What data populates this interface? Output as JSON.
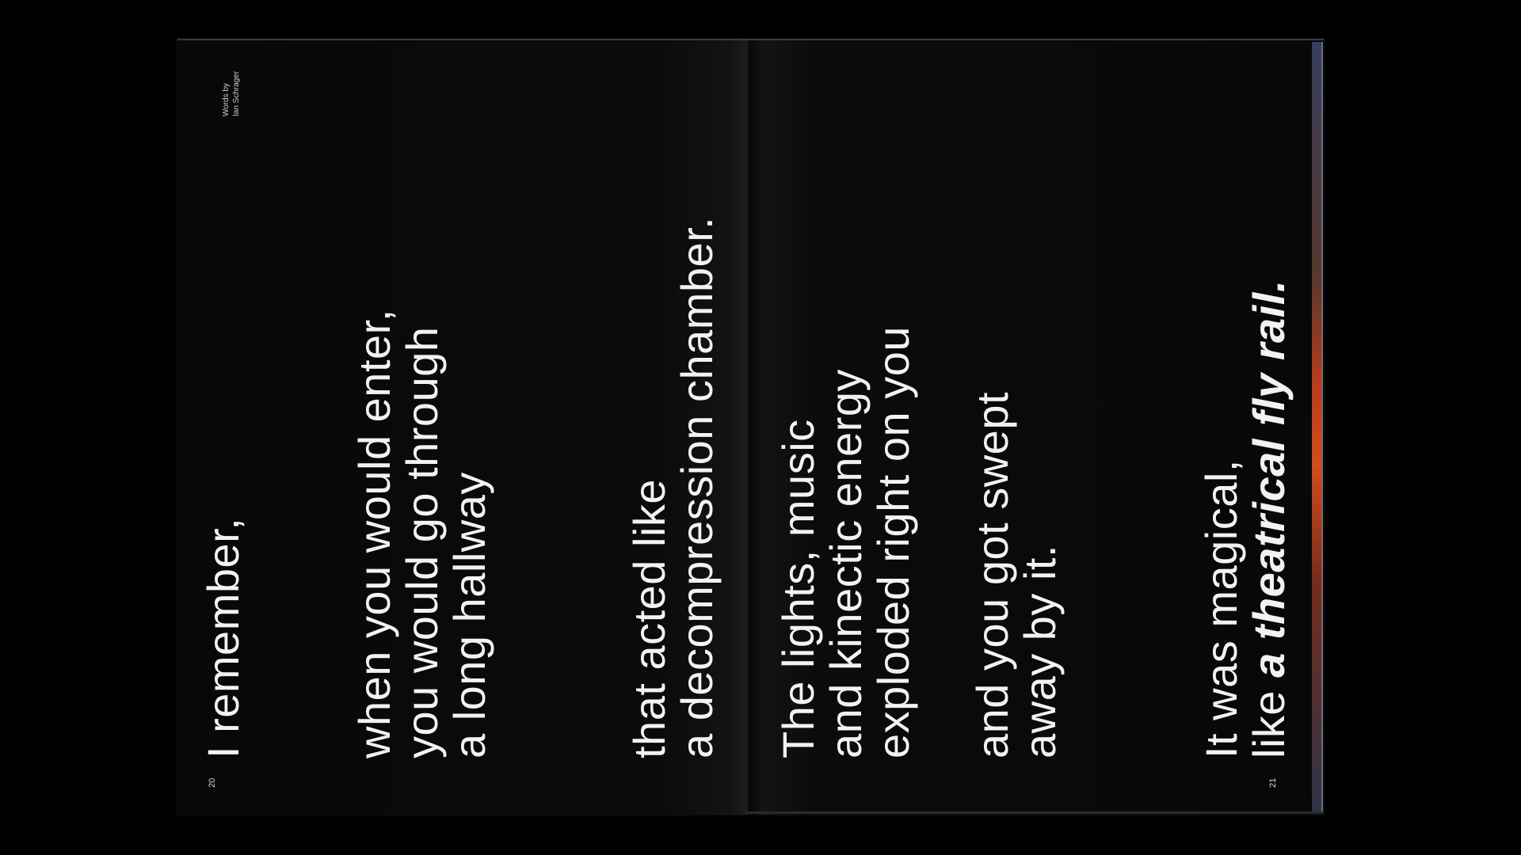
{
  "left_page": {
    "credit": {
      "line1": "Words by",
      "line2": "Ian Schrager"
    },
    "stanza1": "I remember,",
    "stanza2": [
      "when you would enter,",
      "you would go through",
      "a long hallway"
    ],
    "stanza3": [
      "that acted like",
      "a decompression chamber."
    ],
    "page_number": "20"
  },
  "right_page": {
    "stanza4": [
      "The lights, music",
      "and kinectic energy",
      "exploded right on you"
    ],
    "stanza5": [
      "and you got swept",
      "away by it."
    ],
    "stanza6": {
      "line1": "It was magical,",
      "line2_plain": "like ",
      "line2_emph": "a theatrical fly rail."
    },
    "page_number": "21"
  },
  "colors": {
    "background": "#000000",
    "page": "#0a0a0a",
    "text": "#f2f2f2",
    "fore_edge_accent": "#d9521f"
  }
}
